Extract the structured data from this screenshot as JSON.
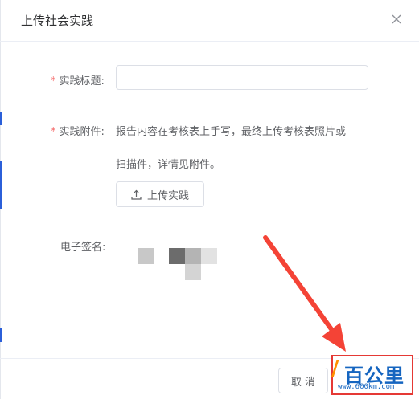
{
  "dialog": {
    "title": "上传社会实践"
  },
  "form": {
    "title_field": {
      "required_mark": "*",
      "label": "实践标题:",
      "value": "",
      "placeholder": ""
    },
    "attachment_field": {
      "required_mark": "*",
      "label": "实践附件:",
      "hint_line1": "报告内容在考核表上手写，最终上传考核表照片或",
      "hint_line2": "扫描件，详情见附件。",
      "upload_label": "上传实践"
    },
    "signature_field": {
      "label": "电子签名:"
    }
  },
  "footer": {
    "cancel_label": "取 消"
  },
  "watermark": {
    "logo_text": "百公里",
    "url_text": "www.600km.com"
  },
  "colors": {
    "required": "#f56c6c",
    "arrow": "#f44336",
    "watermark_border": "#e53935",
    "watermark_text": "#1565c0"
  },
  "icons": {
    "close": "close-icon",
    "upload": "upload-icon",
    "arrow": "red-arrow"
  }
}
